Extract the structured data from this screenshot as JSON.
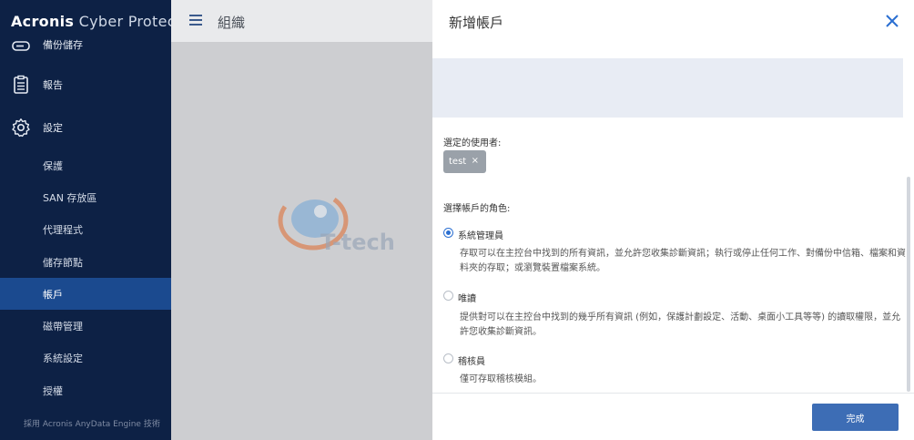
{
  "sidebar": {
    "brand_bold": "Acronis",
    "brand_light": " Cyber Protect",
    "items": [
      {
        "label": "備份儲存",
        "icon": "storage-icon"
      },
      {
        "label": "報告",
        "icon": "report-icon"
      },
      {
        "label": "設定",
        "icon": "gear-icon"
      }
    ],
    "sub_items": [
      {
        "label": "保護"
      },
      {
        "label": "SAN 存放區"
      },
      {
        "label": "代理程式"
      },
      {
        "label": "儲存節點"
      },
      {
        "label": "帳戶"
      },
      {
        "label": "磁帶管理"
      },
      {
        "label": "系統設定"
      },
      {
        "label": "授權"
      }
    ],
    "footer": "採用 Acronis AnyData Engine 技術"
  },
  "main": {
    "title": "組織",
    "menu_icon": "hamburger-icon"
  },
  "watermark": {
    "text": "T-tech",
    "icon": "ttech-logo"
  },
  "panel": {
    "title": "新增帳戶",
    "close_icon": "close-icon",
    "selected_users_label": "選定的使用者:",
    "selected_user": "test",
    "chip_remove": "×",
    "role_label": "選擇帳戶的角色:",
    "roles": [
      {
        "name": "系統管理員",
        "checked": true,
        "desc": "存取可以在主控台中找到的所有資訊，並允許您收集診斷資訊；執行或停止任何工作、對備份中信箱、檔案和資料夾的存取；或瀏覽裝置檔案系統。"
      },
      {
        "name": "唯讀",
        "checked": false,
        "desc": "提供對可以在主控台中找到的幾乎所有資訊 (例如，保護計劃設定、活動、桌面小工具等等) 的讀取權限，並允許您收集診斷資訊。"
      },
      {
        "name": "稽核員",
        "checked": false,
        "desc": "僅可存取稽核模組。"
      }
    ],
    "done_label": "完成"
  },
  "colors": {
    "sidebar_bg": "#0d2145",
    "active_item": "#1b4a8f",
    "accent": "#2b6fd1",
    "button": "#3d6db5"
  }
}
